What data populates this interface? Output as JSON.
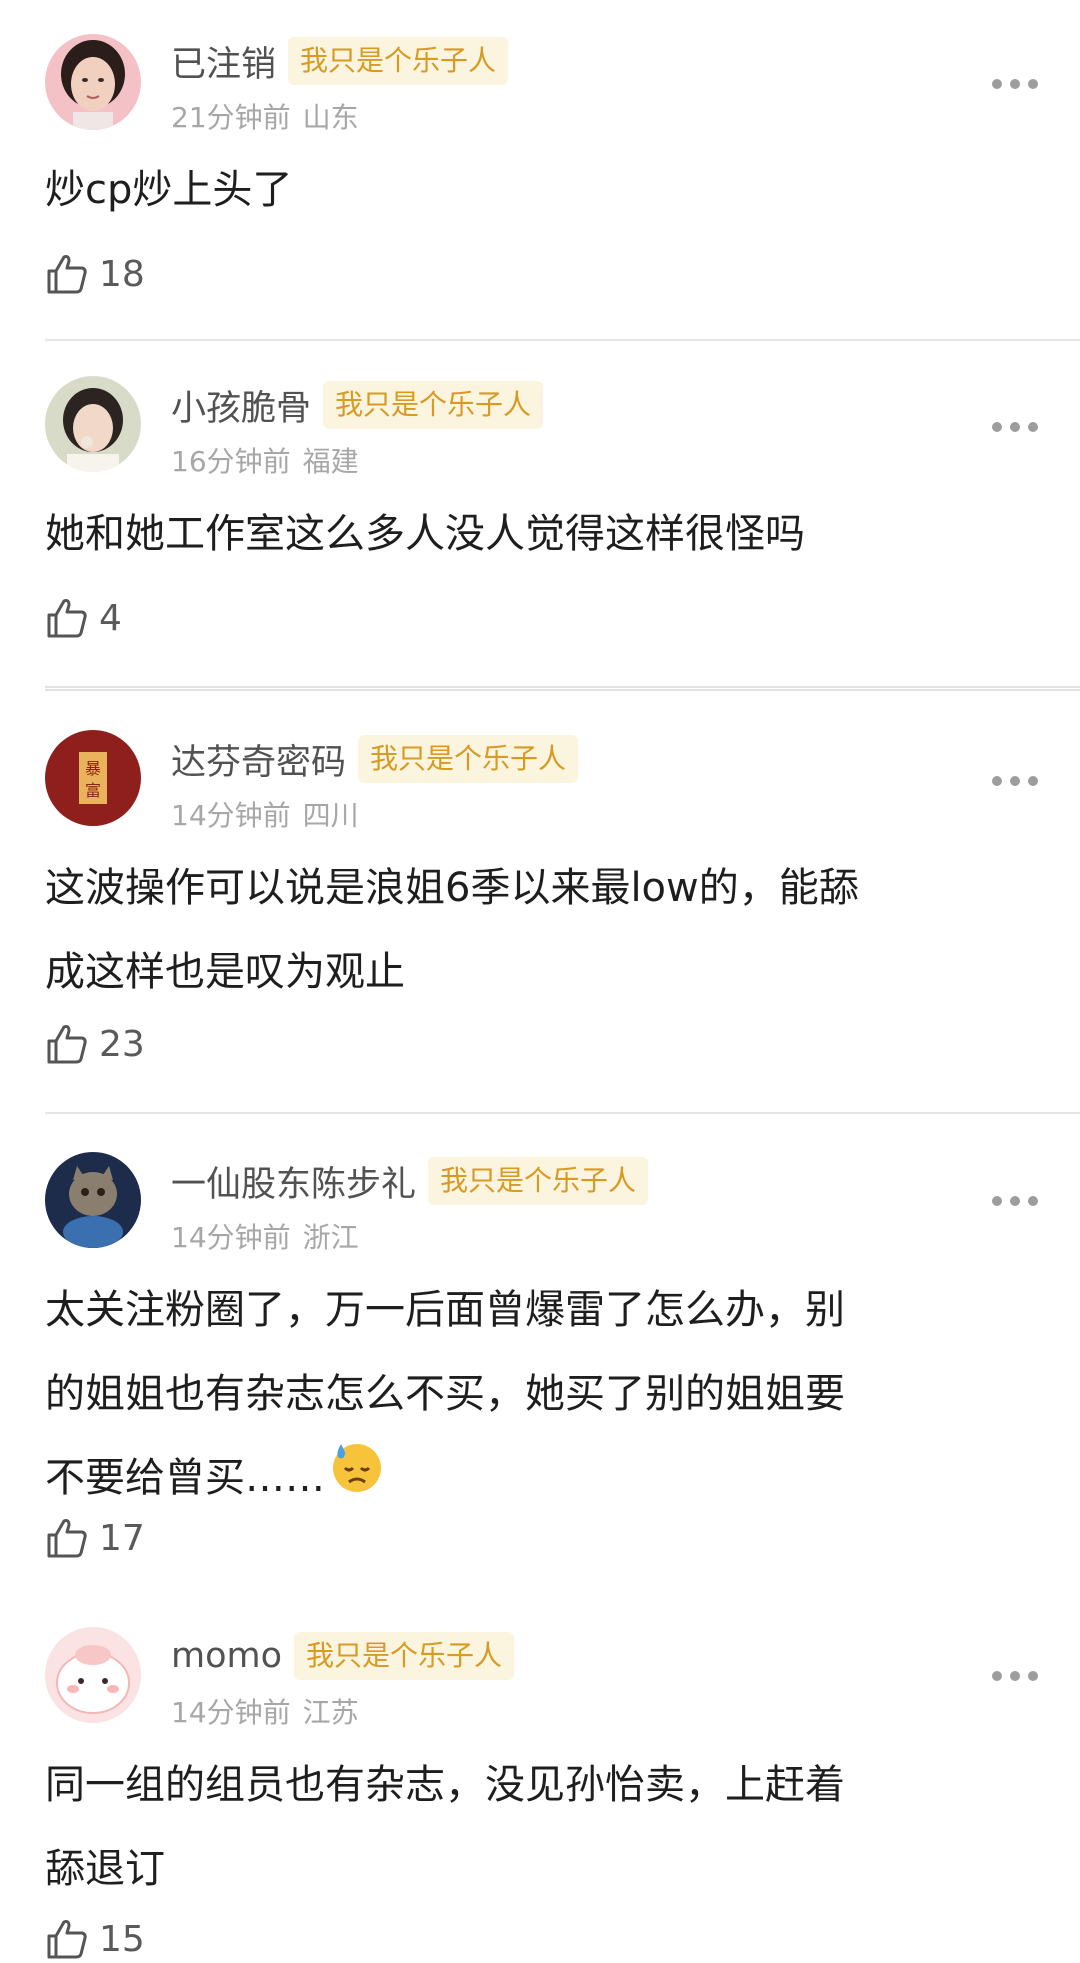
{
  "comments": [
    {
      "username": "已注销",
      "badge": "我只是个乐子人",
      "time": "21分钟前",
      "location": "山东",
      "text": "炒cp炒上头了",
      "likes": "18",
      "avatar": "woman-portrait"
    },
    {
      "username": "小孩脆骨",
      "badge": "我只是个乐子人",
      "time": "16分钟前",
      "location": "福建",
      "text": "她和她工作室这么多人没人觉得这样很怪吗",
      "likes": "4",
      "avatar": "girl-portrait"
    },
    {
      "username": "达芬奇密码",
      "badge": "我只是个乐子人",
      "time": "14分钟前",
      "location": "四川",
      "text": "这波操作可以说是浪姐6季以来最low的，能舔\n成这样也是叹为观止",
      "likes": "23",
      "avatar": "seal-暴富"
    },
    {
      "username": "一仙股东陈步礼",
      "badge": "我只是个乐子人",
      "time": "14分钟前",
      "location": "浙江",
      "text": "太关注粉圈了，万一后面曾爆雷了怎么办，别\n的姐姐也有杂志怎么不买，她买了别的姐姐要\n不要给曾买……",
      "emoji": "sweat-emoji",
      "likes": "17",
      "avatar": "cat-photo"
    },
    {
      "username": "momo",
      "badge": "我只是个乐子人",
      "time": "14分钟前",
      "location": "江苏",
      "text": "同一组的组员也有杂志，没见孙怡卖，上赶着\n舔退订",
      "likes": "15",
      "avatar": "pink-cartoon"
    }
  ],
  "colors": {
    "badge_bg": "#fbf4df",
    "badge_text": "#d79a23",
    "username": "#525252",
    "meta": "#a7a7a7"
  }
}
